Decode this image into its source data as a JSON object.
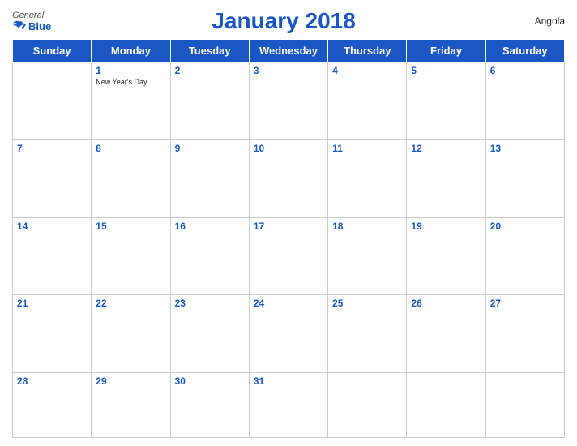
{
  "header": {
    "logo_general": "General",
    "logo_blue": "Blue",
    "title": "January 2018",
    "country": "Angola"
  },
  "days_of_week": [
    "Sunday",
    "Monday",
    "Tuesday",
    "Wednesday",
    "Thursday",
    "Friday",
    "Saturday"
  ],
  "weeks": [
    [
      {
        "date": "",
        "holiday": ""
      },
      {
        "date": "1",
        "holiday": "New Year's Day"
      },
      {
        "date": "2",
        "holiday": ""
      },
      {
        "date": "3",
        "holiday": ""
      },
      {
        "date": "4",
        "holiday": ""
      },
      {
        "date": "5",
        "holiday": ""
      },
      {
        "date": "6",
        "holiday": ""
      }
    ],
    [
      {
        "date": "7",
        "holiday": ""
      },
      {
        "date": "8",
        "holiday": ""
      },
      {
        "date": "9",
        "holiday": ""
      },
      {
        "date": "10",
        "holiday": ""
      },
      {
        "date": "11",
        "holiday": ""
      },
      {
        "date": "12",
        "holiday": ""
      },
      {
        "date": "13",
        "holiday": ""
      }
    ],
    [
      {
        "date": "14",
        "holiday": ""
      },
      {
        "date": "15",
        "holiday": ""
      },
      {
        "date": "16",
        "holiday": ""
      },
      {
        "date": "17",
        "holiday": ""
      },
      {
        "date": "18",
        "holiday": ""
      },
      {
        "date": "19",
        "holiday": ""
      },
      {
        "date": "20",
        "holiday": ""
      }
    ],
    [
      {
        "date": "21",
        "holiday": ""
      },
      {
        "date": "22",
        "holiday": ""
      },
      {
        "date": "23",
        "holiday": ""
      },
      {
        "date": "24",
        "holiday": ""
      },
      {
        "date": "25",
        "holiday": ""
      },
      {
        "date": "26",
        "holiday": ""
      },
      {
        "date": "27",
        "holiday": ""
      }
    ],
    [
      {
        "date": "28",
        "holiday": ""
      },
      {
        "date": "29",
        "holiday": ""
      },
      {
        "date": "30",
        "holiday": ""
      },
      {
        "date": "31",
        "holiday": ""
      },
      {
        "date": "",
        "holiday": ""
      },
      {
        "date": "",
        "holiday": ""
      },
      {
        "date": "",
        "holiday": ""
      }
    ]
  ]
}
